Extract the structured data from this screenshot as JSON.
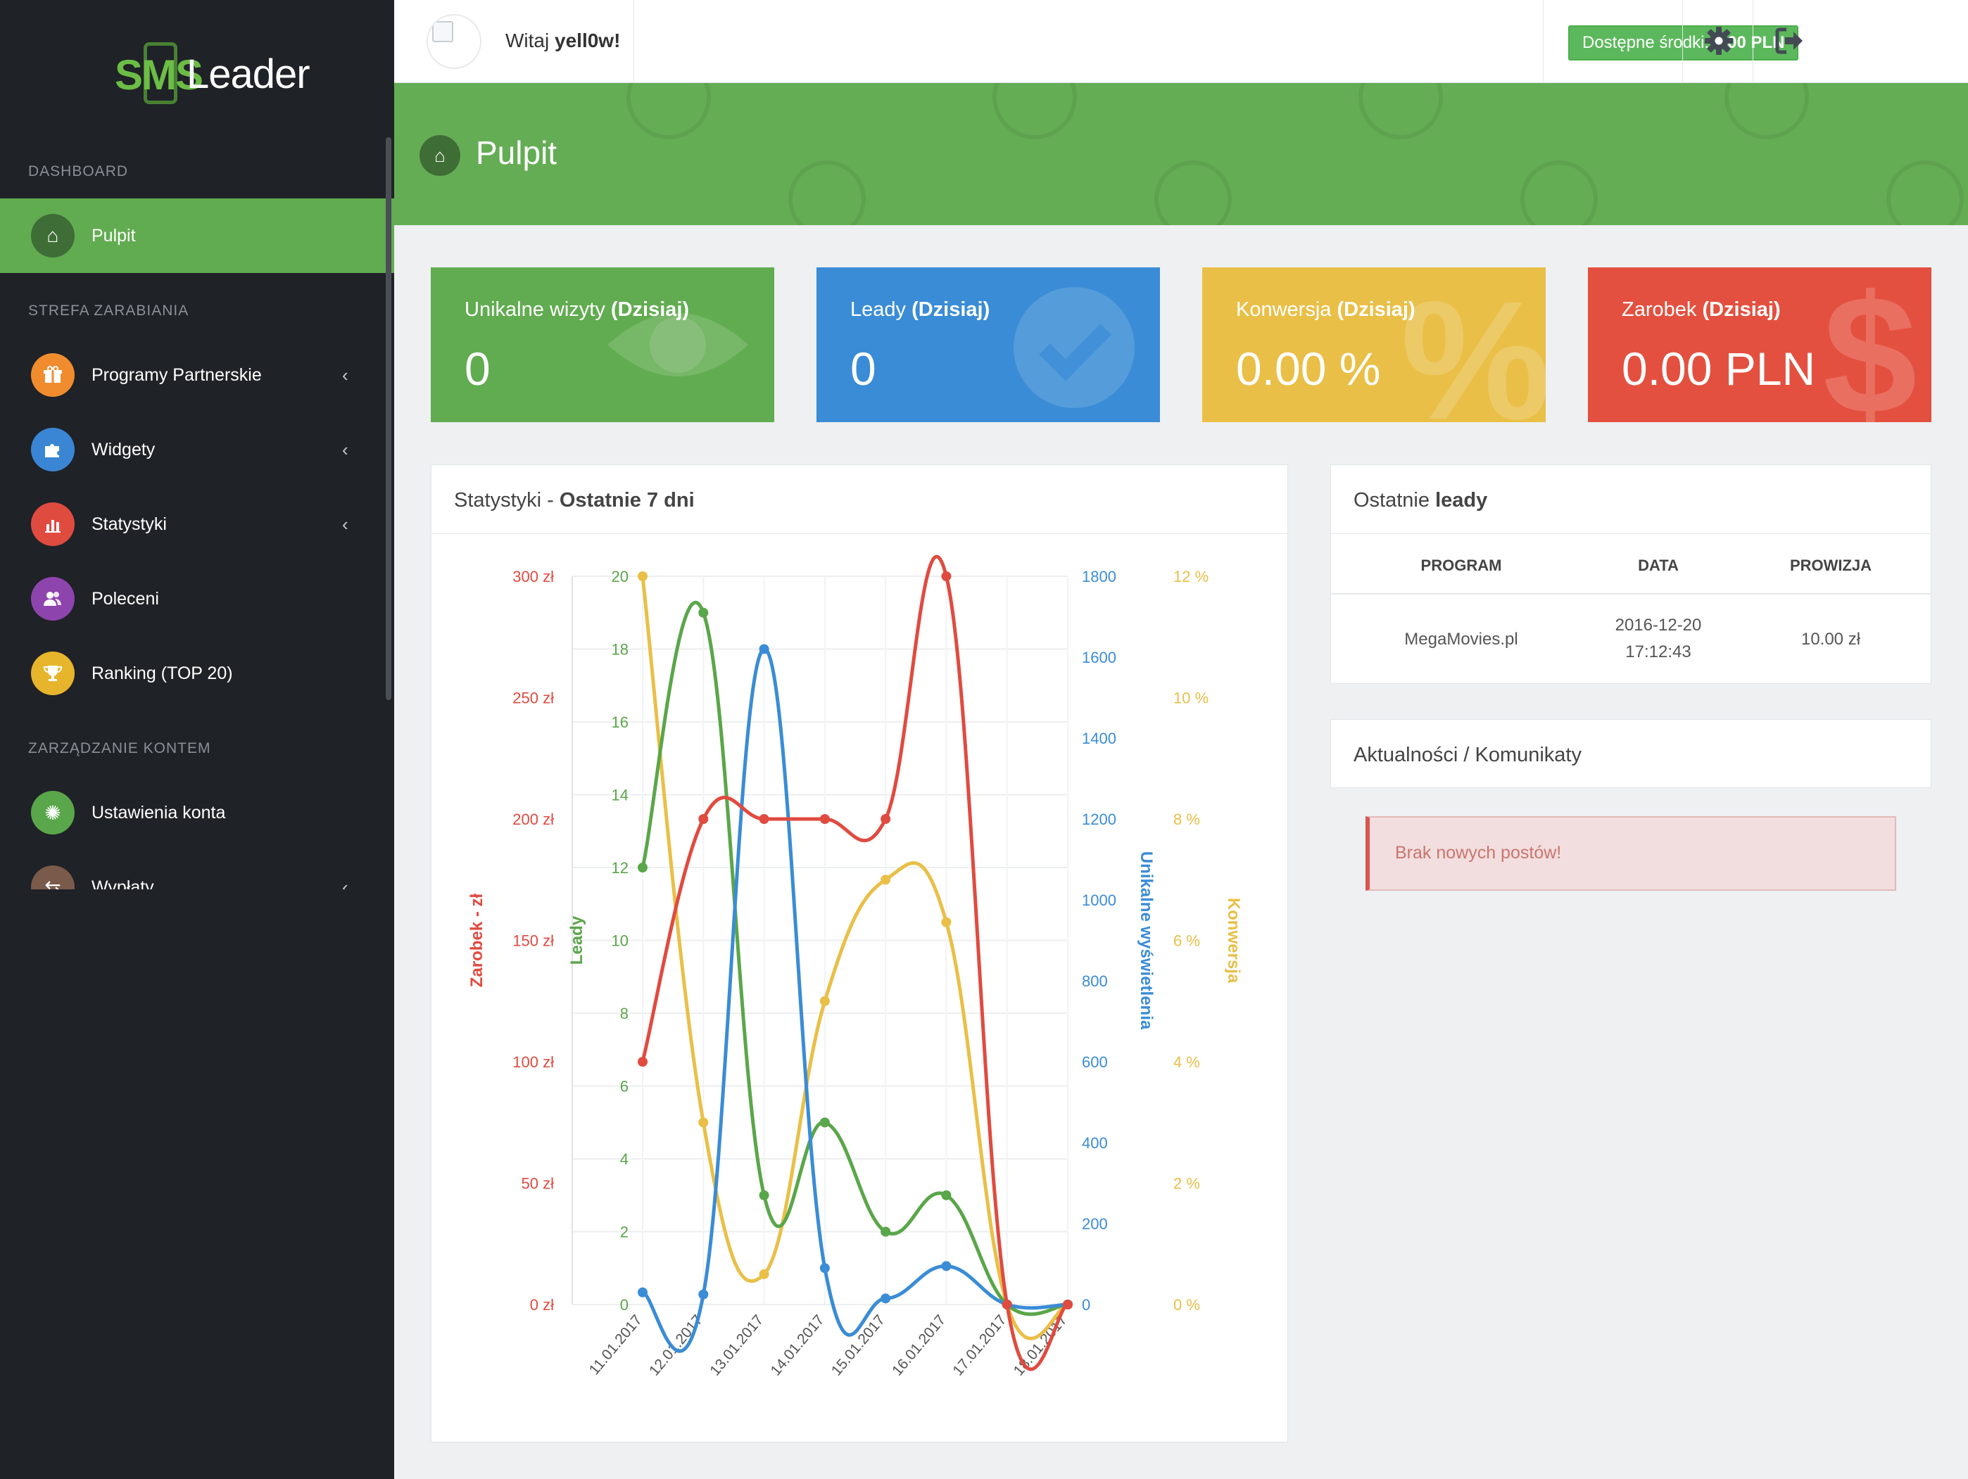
{
  "brand": {
    "sms": "SMS",
    "leader": "Leader"
  },
  "header": {
    "greeting_prefix": "Witaj",
    "username": "yell0w!",
    "funds_label": "Dostępne środki:",
    "funds_value": "0.00 PLN",
    "settings_icon": "gear-icon",
    "logout_icon": "logout-icon"
  },
  "sidebar": {
    "sections": [
      {
        "title": "DASHBOARD"
      },
      {
        "title": "STREFA ZARABIANIA"
      },
      {
        "title": "ZARZĄDZANIE KONTEM"
      }
    ],
    "items": [
      {
        "label": "Pulpit",
        "icon": "home-icon",
        "color": "#3f6d36",
        "active": true
      },
      {
        "label": "Programy Partnerskie",
        "icon": "gift-icon",
        "color": "#f08c2e",
        "chevron": true
      },
      {
        "label": "Widgety",
        "icon": "puzzle-icon",
        "color": "#3a86d4",
        "chevron": true
      },
      {
        "label": "Statystyki",
        "icon": "bar-chart-icon",
        "color": "#e04b40",
        "chevron": true
      },
      {
        "label": "Poleceni",
        "icon": "users-icon",
        "color": "#8e44ad"
      },
      {
        "label": "Ranking (TOP 20)",
        "icon": "trophy-icon",
        "color": "#e7b52c"
      },
      {
        "label": "Ustawienia konta",
        "icon": "gear-icon",
        "color": "#5aa64a"
      },
      {
        "label": "Wypłaty",
        "icon": "exchange-icon",
        "color": "#7a5a4a",
        "chevron": true
      }
    ]
  },
  "page": {
    "title": "Pulpit"
  },
  "cards": [
    {
      "title": "Unikalne wizyty",
      "suffix": "(Dzisiaj)",
      "value": "0",
      "color": "#61ac50",
      "icon": "eye-icon"
    },
    {
      "title": "Leady",
      "suffix": "(Dzisiaj)",
      "value": "0",
      "color": "#3a8cd6",
      "icon": "check-circle-icon"
    },
    {
      "title": "Konwersja",
      "suffix": "(Dzisiaj)",
      "value": "0.00 %",
      "color": "#e9bf47",
      "icon": "percent-icon"
    },
    {
      "title": "Zarobek",
      "suffix": "(Dzisiaj)",
      "value": "0.00 PLN",
      "color": "#e4503f",
      "icon": "dollar-icon"
    }
  ],
  "stats_panel": {
    "title": "Statystyki -",
    "title_bold": "Ostatnie 7 dni"
  },
  "chart_data": {
    "type": "line",
    "categories": [
      "11.01.2017",
      "12.01.2017",
      "13.01.2017",
      "14.01.2017",
      "15.01.2017",
      "16.01.2017",
      "17.01.2017",
      "18.01.2017"
    ],
    "series": [
      {
        "name": "Zarobek - zł",
        "color": "#e04b40",
        "axis": "zarobek",
        "values": [
          100,
          200,
          200,
          200,
          200,
          300,
          0,
          0
        ]
      },
      {
        "name": "Leady",
        "color": "#5aa64a",
        "axis": "leady",
        "values": [
          12,
          19,
          3,
          5,
          2,
          3,
          0,
          0
        ]
      },
      {
        "name": "Unikalne wyświetlenia",
        "color": "#3a8cd6",
        "axis": "views",
        "values": [
          30,
          25,
          1620,
          90,
          15,
          95,
          0,
          0
        ]
      },
      {
        "name": "Konwersja",
        "color": "#e9bf47",
        "axis": "konwersja",
        "values": [
          12,
          3,
          0.5,
          5,
          7,
          6.3,
          0,
          0
        ]
      }
    ],
    "axes": {
      "zarobek": {
        "label": "Zarobek - zł",
        "min": 0,
        "max": 300,
        "ticks": [
          "0 zł",
          "50 zł",
          "100 zł",
          "150 zł",
          "200 zł",
          "250 zł",
          "300 zł"
        ]
      },
      "leady": {
        "label": "Leady",
        "min": 0,
        "max": 20,
        "ticks": [
          "0",
          "2",
          "4",
          "6",
          "8",
          "10",
          "12",
          "14",
          "16",
          "18",
          "20"
        ]
      },
      "views": {
        "label": "Unikalne wyświetlenia",
        "min": 0,
        "max": 1800,
        "ticks": [
          "0",
          "200",
          "400",
          "600",
          "800",
          "1000",
          "1200",
          "1400",
          "1600",
          "1800"
        ]
      },
      "konwersja": {
        "label": "Konwersja",
        "min": 0,
        "max": 12,
        "ticks": [
          "0 %",
          "2 %",
          "4 %",
          "6 %",
          "8 %",
          "10 %",
          "12 %"
        ]
      }
    },
    "grid": true
  },
  "leads_panel": {
    "title": "Ostatnie",
    "title_bold": "leady",
    "columns": [
      "PROGRAM",
      "DATA",
      "PROWIZJA"
    ],
    "rows": [
      {
        "program": "MegaMovies.pl",
        "date": "2016-12-20",
        "time": "17:12:43",
        "commission": "10.00 zł"
      }
    ]
  },
  "news_panel": {
    "title": "Aktualności / Komunikaty",
    "empty": "Brak nowych postów!"
  }
}
